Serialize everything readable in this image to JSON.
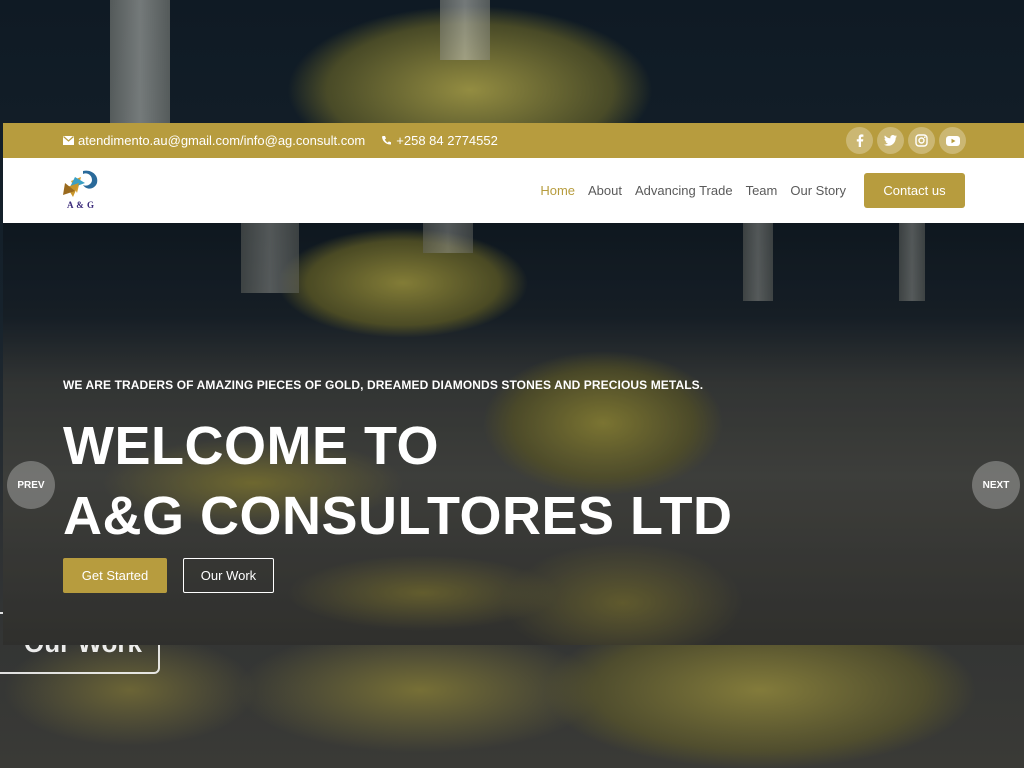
{
  "topbar": {
    "email": "atendimento.au@gmail.com/info@ag.consult.com",
    "phone": "+258 84 2774552",
    "social": [
      "f",
      "t",
      "ig",
      "yt"
    ]
  },
  "brand": {
    "logo_text": "A & G"
  },
  "nav": {
    "items": [
      "Home",
      "About",
      "Advancing Trade",
      "Team",
      "Our Story"
    ],
    "active": "Home",
    "cta": "Contact us"
  },
  "hero": {
    "tagline": "WE ARE TRADERS OF AMAZING PIECES OF GOLD, DREAMED DIAMONDS STONES AND PRECIOUS METALS.",
    "title_line1": "WELCOME TO",
    "title_line2": "A&G CONSULTORES LTD",
    "primary_button": "Get Started",
    "secondary_button": "Our Work"
  },
  "slider": {
    "prev": "PREV",
    "next": "NEXT"
  },
  "background": {
    "button_text": "Our Work"
  },
  "colors": {
    "accent": "#b79c3e",
    "white": "#ffffff"
  }
}
